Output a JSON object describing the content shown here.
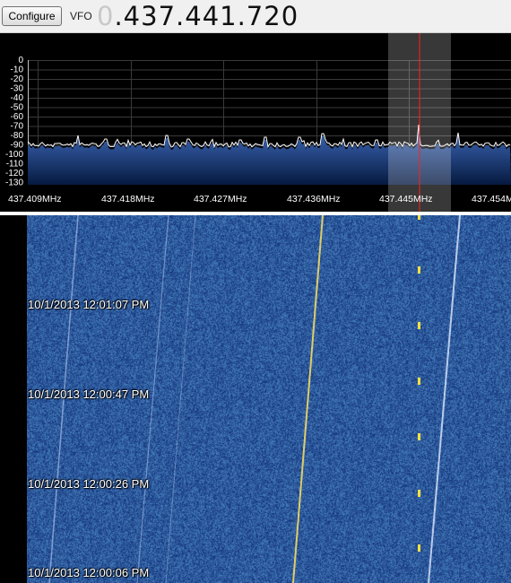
{
  "toolbar": {
    "configure_label": "Configure",
    "vfo_label": "VFO",
    "vfo_leading_digit": "0",
    "vfo_value": ".437.441.720"
  },
  "spectrum": {
    "db_labels": [
      "0",
      "-10",
      "-20",
      "-30",
      "-40",
      "-50",
      "-60",
      "-70",
      "-80",
      "-90",
      "-100",
      "-110",
      "-120",
      "-130"
    ],
    "freq_labels": [
      "437.409MHz",
      "437.418MHz",
      "437.427MHz",
      "437.436MHz",
      "437.445MHz",
      "437.454M"
    ],
    "colors": {
      "trace": "#ffffff",
      "marker": "#ff2020",
      "fill_top": "#3f6bbd",
      "fill_bottom": "#061a40"
    }
  },
  "waterfall": {
    "timestamps": [
      "10/1/2013 12:01:07 PM",
      "10/1/2013 12:00:47 PM",
      "10/1/2013 12:00:26 PM",
      "10/1/2013 12:00:06 PM"
    ],
    "colors": {
      "background": "#1a3fb0",
      "signal": "#ffe040"
    }
  }
}
